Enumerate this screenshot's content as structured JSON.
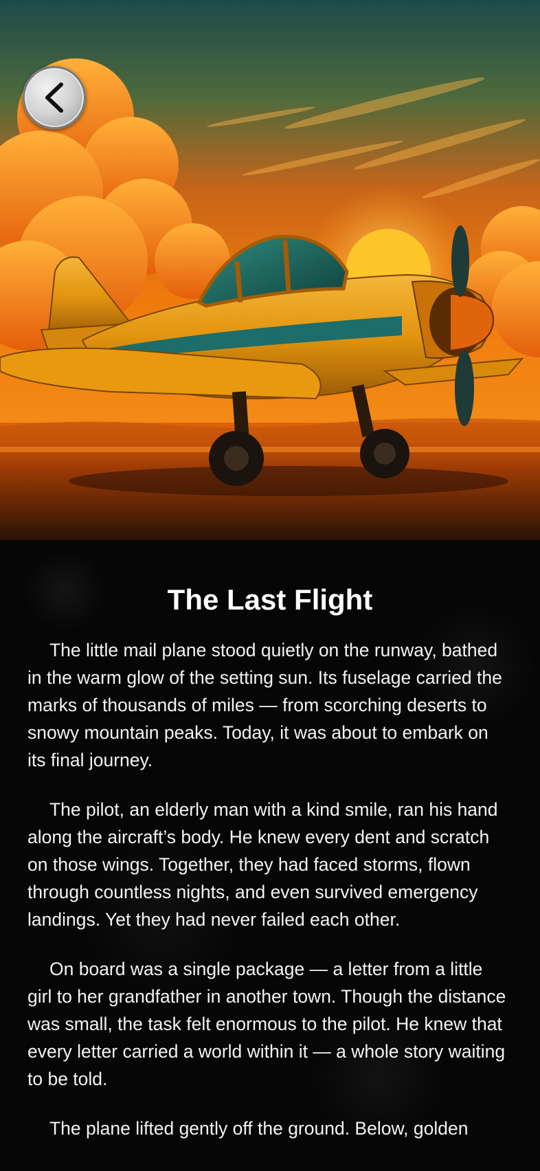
{
  "hero": {
    "image_description_icon": "airplane-sunset-illustration",
    "colors": {
      "sky_top": "#1d4a4b",
      "sky_orange": "#f07a0c",
      "sun": "#ffc62a",
      "plane_body": "#e2940f",
      "plane_stripe": "#1d6d6a"
    }
  },
  "back_button": {
    "icon": "chevron-left-icon"
  },
  "story": {
    "title": "The Last Flight",
    "paragraphs": [
      "The little mail plane stood quietly on the runway, bathed in the warm glow of the setting sun. Its fuselage carried the marks of thousands of miles — from scorching deserts to snowy mountain peaks. Today, it was about to embark on its final journey.",
      "The pilot, an elderly man with a kind smile, ran his hand along the aircraft’s body. He knew every dent and scratch on those wings. Together, they had faced storms, flown through countless nights, and even survived emergency landings. Yet they had never failed each other.",
      "On board was a single package — a letter from a little girl to her grandfather in another town. Though the distance was small, the task felt enormous to the pilot. He knew that every letter carried a world within it — a whole story waiting to be told.",
      "The plane lifted gently off the ground. Below, golden"
    ]
  }
}
